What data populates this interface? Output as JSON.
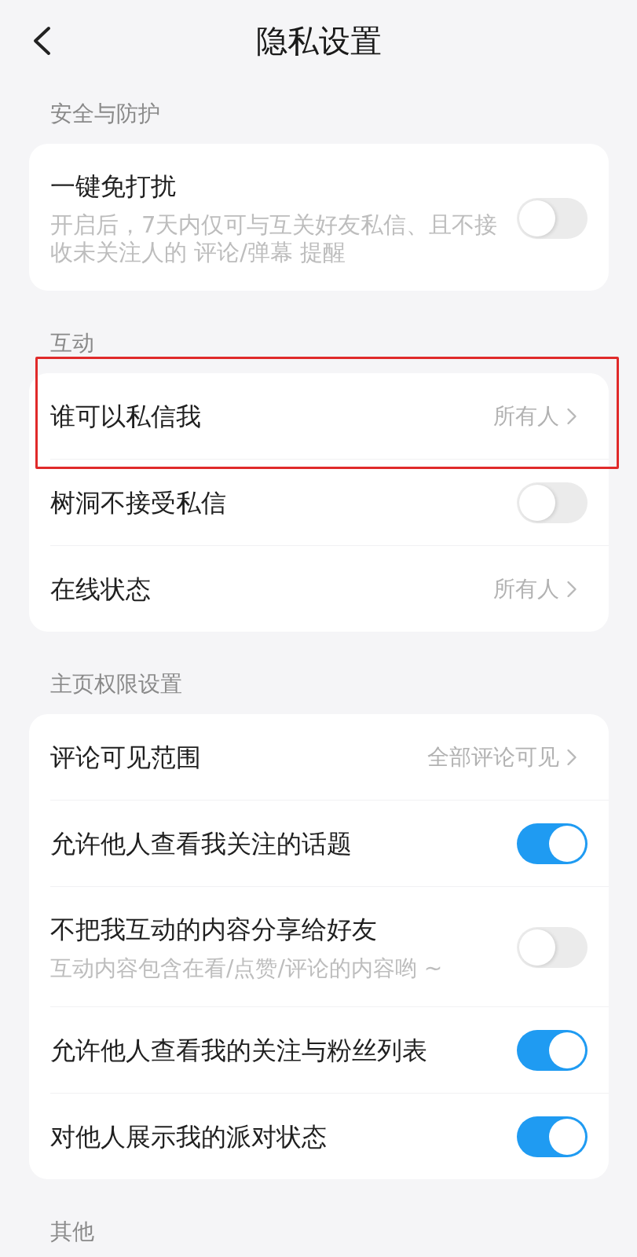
{
  "header": {
    "title": "隐私设置"
  },
  "sections": [
    {
      "title": "安全与防护",
      "items": [
        {
          "kind": "toggle",
          "label": "一键免打扰",
          "description": "开启后，7天内仅可与互关好友私信、且不接收未关注人的 评论/弹幕 提醒",
          "on": false,
          "highlighted": false
        }
      ]
    },
    {
      "title": "互动",
      "items": [
        {
          "kind": "choice",
          "label": "谁可以私信我",
          "value": "所有人",
          "highlighted": true
        },
        {
          "kind": "toggle",
          "label": "树洞不接受私信",
          "on": false,
          "highlighted": false
        },
        {
          "kind": "choice",
          "label": "在线状态",
          "value": "所有人",
          "highlighted": false
        }
      ]
    },
    {
      "title": "主页权限设置",
      "items": [
        {
          "kind": "choice",
          "label": "评论可见范围",
          "value": "全部评论可见",
          "highlighted": false
        },
        {
          "kind": "toggle",
          "label": "允许他人查看我关注的话题",
          "on": true,
          "highlighted": false
        },
        {
          "kind": "toggle",
          "label": "不把我互动的内容分享给好友",
          "description": "互动内容包含在看/点赞/评论的内容哟 ~",
          "on": false,
          "highlighted": false
        },
        {
          "kind": "toggle",
          "label": "允许他人查看我的关注与粉丝列表",
          "on": true,
          "highlighted": false
        },
        {
          "kind": "toggle",
          "label": "对他人展示我的派对状态",
          "on": true,
          "highlighted": false
        }
      ]
    },
    {
      "title": "其他"
    }
  ]
}
